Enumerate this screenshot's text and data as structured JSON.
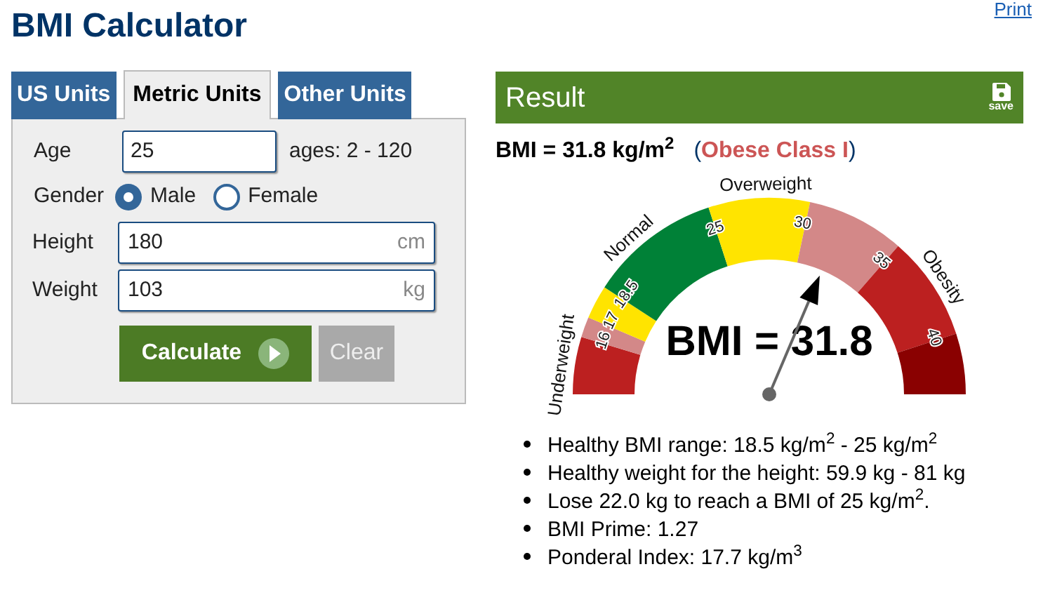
{
  "title": "BMI Calculator",
  "print_link": "Print",
  "tabs": [
    {
      "label": "US Units",
      "selected": false
    },
    {
      "label": "Metric Units",
      "selected": true
    },
    {
      "label": "Other Units",
      "selected": false
    }
  ],
  "form": {
    "age": {
      "label": "Age",
      "value": "25",
      "hint": "ages: 2 - 120"
    },
    "gender": {
      "label": "Gender",
      "options": [
        {
          "label": "Male",
          "selected": true
        },
        {
          "label": "Female",
          "selected": false
        }
      ]
    },
    "height": {
      "label": "Height",
      "value": "180",
      "unit": "cm"
    },
    "weight": {
      "label": "Weight",
      "value": "103",
      "unit": "kg"
    },
    "buttons": [
      {
        "kind": "primary",
        "label": "Calculate"
      },
      {
        "kind": "secondary",
        "label": "Clear"
      }
    ]
  },
  "result": {
    "title": "Result",
    "save_label": "save",
    "bmi_text": "BMI = 31.8 kg/m$^{2}$",
    "category": {
      "open": "(",
      "text": "Obese Class I",
      "close": ")"
    },
    "gauge": {
      "value_text": "BMI = 31.8",
      "segments": [
        {
          "color": "#bc2020"
        },
        {
          "color": "#d38888"
        },
        {
          "color": "#ffe400"
        },
        {
          "color": "#008137"
        },
        {
          "color": "#ffe400"
        },
        {
          "color": "#d38888"
        },
        {
          "color": "#bc2020"
        },
        {
          "color": "#8a0101"
        }
      ],
      "ticks": [
        "16",
        "17",
        "18.5",
        "25",
        "30",
        "35",
        "40"
      ],
      "zones": [
        "Underweight",
        "Normal",
        "Overweight",
        "Obesity"
      ]
    },
    "facts": [
      "Healthy BMI range: 18.5 kg/m$^{2}$ - 25 kg/m$^{2}$",
      "Healthy weight for the height: 59.9 kg - 81 kg",
      "Lose 22.0 kg to reach a BMI of 25 kg/m$^{2}$.",
      "BMI Prime: 1.27",
      "Ponderal Index: 17.7 kg/m$^{3}$"
    ]
  }
}
